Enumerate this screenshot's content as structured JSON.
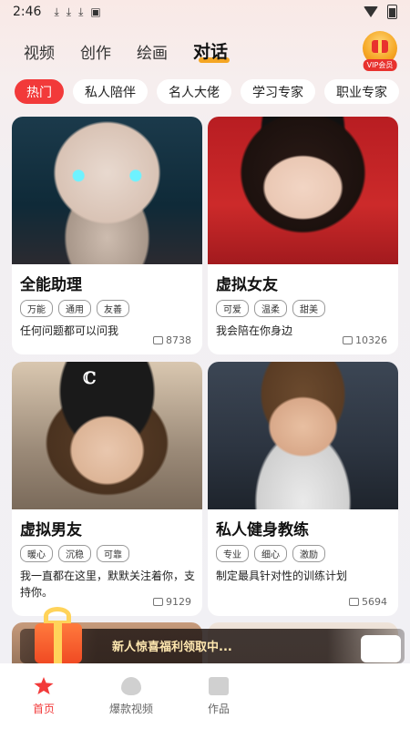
{
  "status_bar": {
    "time": "2:46"
  },
  "top_tabs": [
    {
      "label": "视频",
      "active": false
    },
    {
      "label": "创作",
      "active": false
    },
    {
      "label": "绘画",
      "active": false
    },
    {
      "label": "对话",
      "active": true
    }
  ],
  "vip_label": "VIP会员",
  "categories": [
    {
      "label": "热门",
      "active": true
    },
    {
      "label": "私人陪伴",
      "active": false
    },
    {
      "label": "名人大佬",
      "active": false
    },
    {
      "label": "学习专家",
      "active": false
    },
    {
      "label": "职业专家",
      "active": false
    }
  ],
  "cards": [
    {
      "title": "全能助理",
      "tags": [
        "万能",
        "通用",
        "友善"
      ],
      "desc": "任何问题都可以问我",
      "count": "8738"
    },
    {
      "title": "虚拟女友",
      "tags": [
        "可爱",
        "温柔",
        "甜美"
      ],
      "desc": "我会陪在你身边",
      "count": "10326"
    },
    {
      "title": "虚拟男友",
      "tags": [
        "暖心",
        "沉稳",
        "可靠"
      ],
      "desc": "我一直都在这里，默默关注着你，支持你。",
      "count": "9129"
    },
    {
      "title": "私人健身教练",
      "tags": [
        "专业",
        "细心",
        "激励"
      ],
      "desc": "制定最具针对性的训练计划",
      "count": "5694"
    }
  ],
  "promo": {
    "text": "新人惊喜福利领取中..."
  },
  "bottom_nav": [
    {
      "label": "首页",
      "icon": "home-icon",
      "active": true
    },
    {
      "label": "爆款视频",
      "icon": "fire-icon",
      "active": false
    },
    {
      "label": "作品",
      "icon": "works-icon",
      "active": false
    }
  ],
  "colors": {
    "accent": "#f23a3a",
    "tab_underline": "#f5a623"
  }
}
